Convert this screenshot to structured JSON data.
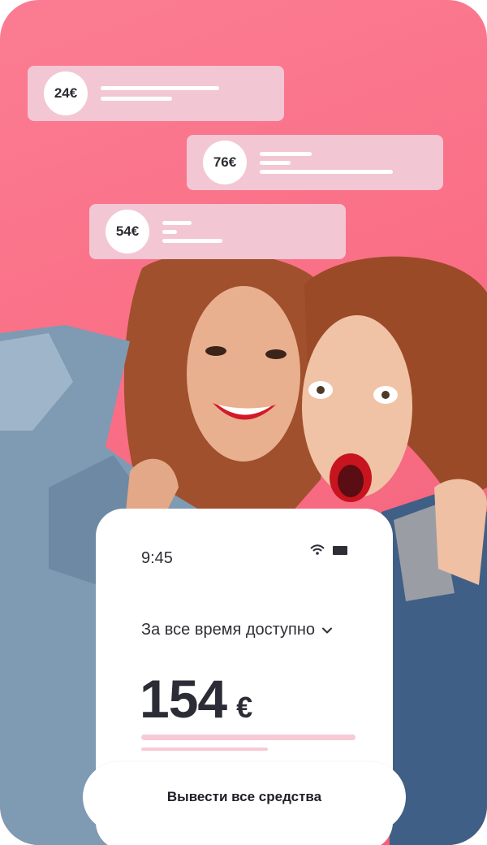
{
  "notifications": [
    {
      "amount": "24€"
    },
    {
      "amount": "76€"
    },
    {
      "amount": "54€"
    }
  ],
  "status_bar": {
    "time": "9:45",
    "icons": [
      "wifi-icon",
      "battery-icon"
    ]
  },
  "period_selector": {
    "label": "За все время доступно",
    "icon": "chevron-down-icon"
  },
  "balance": {
    "amount": "154",
    "currency": "€"
  },
  "actions": {
    "withdraw_label": "Вывести все средства"
  },
  "colors": {
    "background": "#fa6f86",
    "chip": "#f3c6d3",
    "accent_bar": "#f7cad6",
    "text": "#2c2c36"
  }
}
